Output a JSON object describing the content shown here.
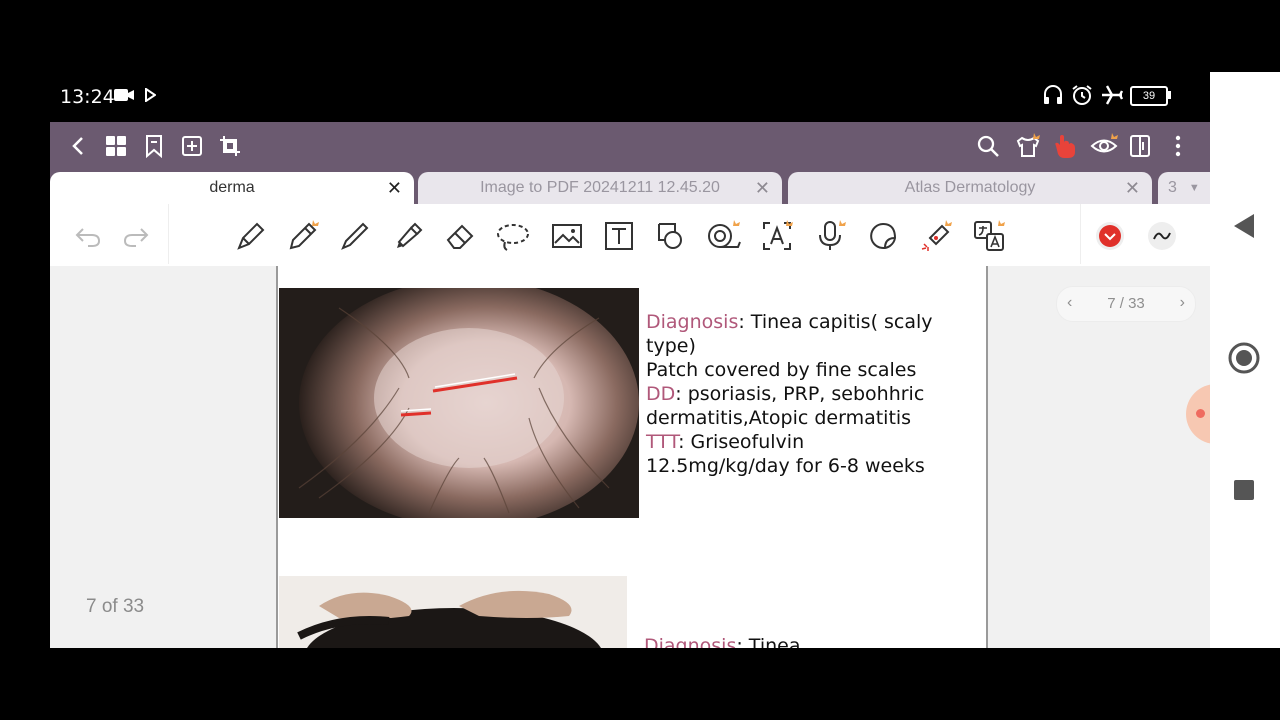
{
  "status_bar": {
    "time": "13:24",
    "battery": "39"
  },
  "app": {
    "tabs": [
      {
        "label": "derma",
        "active": true
      },
      {
        "label": "Image to PDF 20241211 12.45.20",
        "active": false
      },
      {
        "label": "Atlas Dermatology",
        "active": false
      },
      {
        "label": "3",
        "active": false
      }
    ],
    "colors": {
      "accent": "#6b5a70",
      "highlight_text": "#b0587a",
      "record": "#e0302a"
    }
  },
  "document": {
    "page_indicator": "7 / 33",
    "page_count_label": "7 of 33",
    "block1": {
      "diagnosis_label": "Diagnosis",
      "diagnosis_value": ": Tinea capitis( scaly type)",
      "line2": "Patch covered by fine scales",
      "dd_label": "DD",
      "dd_value": ": psoriasis, PRP, sebohhric",
      "dd_line2": "dermatitis,Atopic dermatitis",
      "ttt_label": "TTT",
      "ttt_value": ": Griseofulvin",
      "ttt_line2": "12.5mg/kg/day for 6-8 weeks"
    },
    "block2": {
      "diagnosis_label": "Diagnosis",
      "diagnosis_value": ": Tinea"
    }
  }
}
